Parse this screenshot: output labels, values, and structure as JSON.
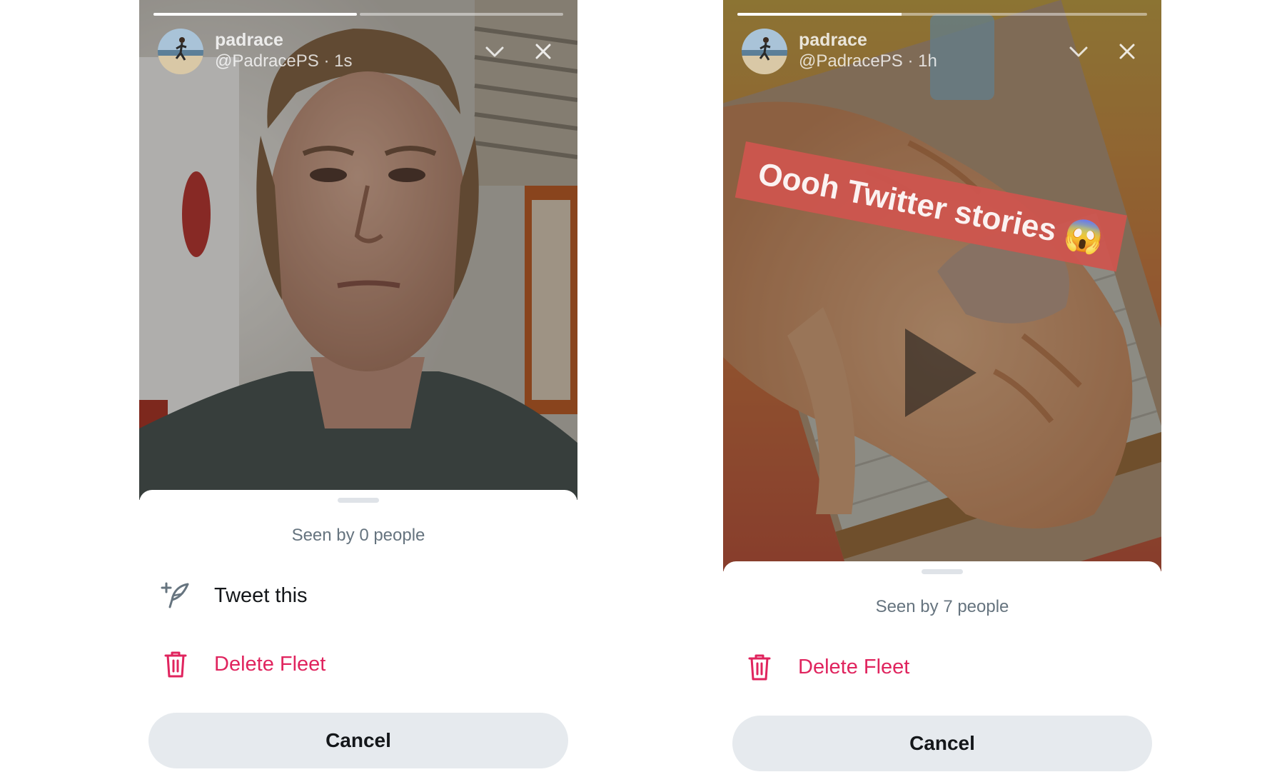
{
  "left_fleet": {
    "progress_segments": [
      1.0,
      0.0
    ],
    "user": {
      "name": "padrace",
      "meta": "@PadracePS · 1s"
    },
    "sheet": {
      "seen_text": "Seen by 0 people",
      "actions": [
        {
          "label": "Tweet this",
          "icon": "tweet-compose-icon",
          "color": "#14171a"
        },
        {
          "label": "Delete Fleet",
          "icon": "trash-icon",
          "color": "#e0245e"
        }
      ],
      "cancel_label": "Cancel"
    }
  },
  "right_fleet": {
    "progress_segments": [
      0.4
    ],
    "user": {
      "name": "padrace",
      "meta": "@PadracePS · 1h"
    },
    "sticker_text": "Oooh Twitter stories 😱",
    "sheet": {
      "seen_text": "Seen by 7 people",
      "actions": [
        {
          "label": "Delete Fleet",
          "icon": "trash-icon",
          "color": "#e0245e"
        }
      ],
      "cancel_label": "Cancel"
    }
  },
  "colors": {
    "delete": "#e0245e",
    "cancel_bg": "#e6eaee",
    "muted_text": "#66747f"
  }
}
